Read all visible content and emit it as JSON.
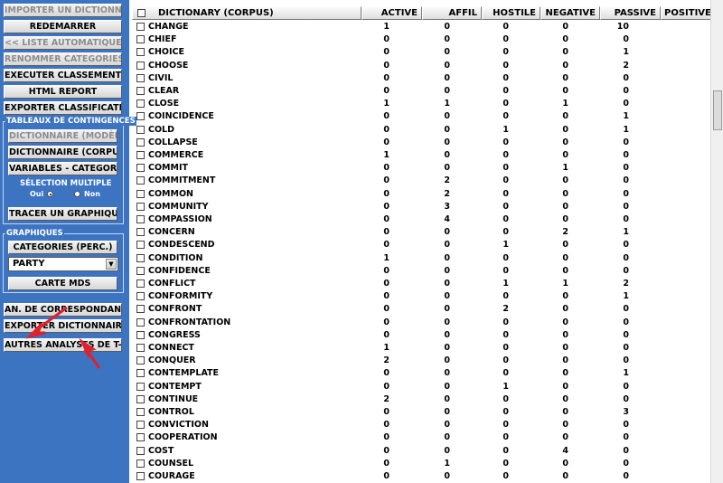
{
  "left_panel": {
    "btn_import": "IMPORTER UN DICTIONNAIRE",
    "btn_restart": "REDEMARRER",
    "btn_auto_list": "<< LISTE AUTOMATIQUE <<",
    "btn_rename": "RENOMMER CATEGORIES",
    "btn_run": "EXECUTER CLASSEMENT",
    "btn_html": "HTML REPORT",
    "btn_export_class": "EXPORTER CLASSIFICATION",
    "contingency_title": "TABLEAUX DE CONTINGENCES",
    "btn_dict_model": "DICTIONNAIRE (MODÈLE)",
    "btn_dict_corpus": "DICTIONNAIRE (CORPUS)",
    "btn_vars": "VARIABLES - CATEGORIES",
    "multi_select_label": "SÉLECTION MULTIPLE",
    "radio_yes": "Oui",
    "radio_no": "Non",
    "btn_plot": "TRACER UN GRAPHIQUE",
    "graphics_title": "GRAPHIQUES",
    "btn_categories": "CATEGORIES (PERC.)",
    "party_select": "PARTY",
    "btn_mds": "CARTE MDS",
    "btn_corresp": "AN. DE CORRESPONDANCES",
    "btn_export_dict": "EXPORTER DICTIONNAIRE",
    "btn_other": "AUTRES ANALYSES DE T-LAB"
  },
  "table": {
    "headers": [
      "DICTIONARY (CORPUS)",
      "ACTIVE",
      "AFFIL",
      "HOSTILE",
      "NEGATIVE",
      "PASSIVE",
      "POSITIVE"
    ],
    "rows": [
      {
        "word": "CHANGE",
        "vals": [
          "1",
          "0",
          "0",
          "0",
          "10"
        ]
      },
      {
        "word": "CHIEF",
        "vals": [
          "0",
          "0",
          "0",
          "0",
          "0"
        ]
      },
      {
        "word": "CHOICE",
        "vals": [
          "0",
          "0",
          "0",
          "0",
          "1"
        ]
      },
      {
        "word": "CHOOSE",
        "vals": [
          "0",
          "0",
          "0",
          "0",
          "2"
        ]
      },
      {
        "word": "CIVIL",
        "vals": [
          "0",
          "0",
          "0",
          "0",
          "0"
        ]
      },
      {
        "word": "CLEAR",
        "vals": [
          "0",
          "0",
          "0",
          "0",
          "0"
        ]
      },
      {
        "word": "CLOSE",
        "vals": [
          "1",
          "1",
          "0",
          "1",
          "0"
        ]
      },
      {
        "word": "COINCIDENCE",
        "vals": [
          "0",
          "0",
          "0",
          "0",
          "1"
        ]
      },
      {
        "word": "COLD",
        "vals": [
          "0",
          "0",
          "1",
          "0",
          "1"
        ]
      },
      {
        "word": "COLLAPSE",
        "vals": [
          "0",
          "0",
          "0",
          "0",
          "0"
        ]
      },
      {
        "word": "COMMERCE",
        "vals": [
          "1",
          "0",
          "0",
          "0",
          "0"
        ]
      },
      {
        "word": "COMMIT",
        "vals": [
          "0",
          "0",
          "0",
          "1",
          "0"
        ]
      },
      {
        "word": "COMMITMENT",
        "vals": [
          "0",
          "2",
          "0",
          "0",
          "0"
        ]
      },
      {
        "word": "COMMON",
        "vals": [
          "0",
          "2",
          "0",
          "0",
          "0"
        ]
      },
      {
        "word": "COMMUNITY",
        "vals": [
          "0",
          "3",
          "0",
          "0",
          "0"
        ]
      },
      {
        "word": "COMPASSION",
        "vals": [
          "0",
          "4",
          "0",
          "0",
          "0"
        ]
      },
      {
        "word": "CONCERN",
        "vals": [
          "0",
          "0",
          "0",
          "2",
          "1"
        ]
      },
      {
        "word": "CONDESCEND",
        "vals": [
          "0",
          "0",
          "1",
          "0",
          "0"
        ]
      },
      {
        "word": "CONDITION",
        "vals": [
          "1",
          "0",
          "0",
          "0",
          "0"
        ]
      },
      {
        "word": "CONFIDENCE",
        "vals": [
          "0",
          "0",
          "0",
          "0",
          "0"
        ]
      },
      {
        "word": "CONFLICT",
        "vals": [
          "0",
          "0",
          "1",
          "1",
          "2"
        ]
      },
      {
        "word": "CONFORMITY",
        "vals": [
          "0",
          "0",
          "0",
          "0",
          "1"
        ]
      },
      {
        "word": "CONFRONT",
        "vals": [
          "0",
          "0",
          "2",
          "0",
          "0"
        ]
      },
      {
        "word": "CONFRONTATION",
        "vals": [
          "0",
          "0",
          "0",
          "0",
          "0"
        ]
      },
      {
        "word": "CONGRESS",
        "vals": [
          "0",
          "0",
          "0",
          "0",
          "0"
        ]
      },
      {
        "word": "CONNECT",
        "vals": [
          "1",
          "0",
          "0",
          "0",
          "0"
        ]
      },
      {
        "word": "CONQUER",
        "vals": [
          "2",
          "0",
          "0",
          "0",
          "0"
        ]
      },
      {
        "word": "CONTEMPLATE",
        "vals": [
          "0",
          "0",
          "0",
          "0",
          "1"
        ]
      },
      {
        "word": "CONTEMPT",
        "vals": [
          "0",
          "0",
          "1",
          "0",
          "0"
        ]
      },
      {
        "word": "CONTINUE",
        "vals": [
          "2",
          "0",
          "0",
          "0",
          "0"
        ]
      },
      {
        "word": "CONTROL",
        "vals": [
          "0",
          "0",
          "0",
          "0",
          "3"
        ]
      },
      {
        "word": "CONVICTION",
        "vals": [
          "0",
          "0",
          "0",
          "0",
          "0"
        ]
      },
      {
        "word": "COOPERATION",
        "vals": [
          "0",
          "0",
          "0",
          "0",
          "0"
        ]
      },
      {
        "word": "COST",
        "vals": [
          "0",
          "0",
          "0",
          "4",
          "0"
        ]
      },
      {
        "word": "COUNSEL",
        "vals": [
          "0",
          "1",
          "0",
          "0",
          "0"
        ]
      },
      {
        "word": "COURAGE",
        "vals": [
          "0",
          "0",
          "0",
          "0",
          "0"
        ]
      }
    ]
  },
  "colors": {
    "panel_bg": "#3c74c2",
    "annotation_arrow": "#e0202a"
  }
}
